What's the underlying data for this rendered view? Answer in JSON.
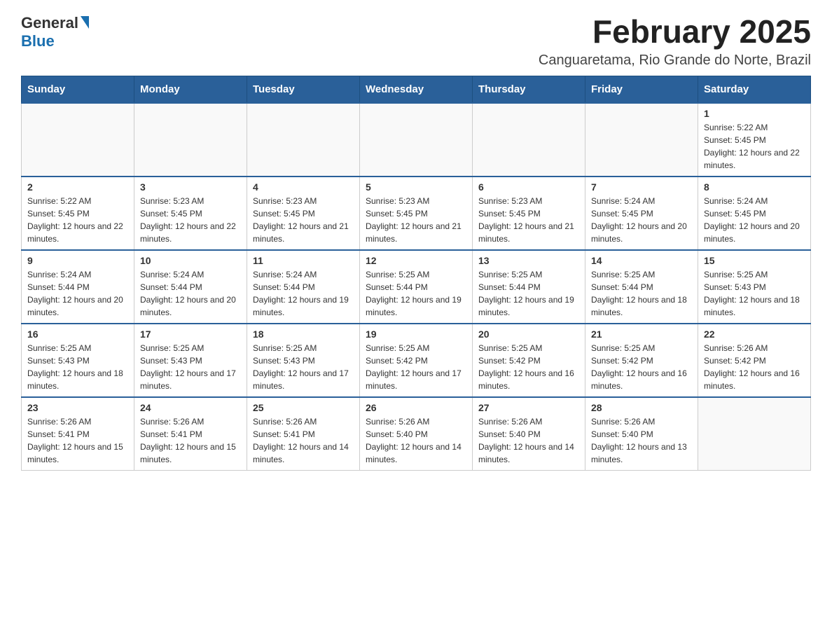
{
  "header": {
    "logo_general": "General",
    "logo_blue": "Blue",
    "title": "February 2025",
    "subtitle": "Canguaretama, Rio Grande do Norte, Brazil"
  },
  "days_of_week": [
    "Sunday",
    "Monday",
    "Tuesday",
    "Wednesday",
    "Thursday",
    "Friday",
    "Saturday"
  ],
  "weeks": [
    [
      {
        "day": "",
        "info": ""
      },
      {
        "day": "",
        "info": ""
      },
      {
        "day": "",
        "info": ""
      },
      {
        "day": "",
        "info": ""
      },
      {
        "day": "",
        "info": ""
      },
      {
        "day": "",
        "info": ""
      },
      {
        "day": "1",
        "info": "Sunrise: 5:22 AM\nSunset: 5:45 PM\nDaylight: 12 hours and 22 minutes."
      }
    ],
    [
      {
        "day": "2",
        "info": "Sunrise: 5:22 AM\nSunset: 5:45 PM\nDaylight: 12 hours and 22 minutes."
      },
      {
        "day": "3",
        "info": "Sunrise: 5:23 AM\nSunset: 5:45 PM\nDaylight: 12 hours and 22 minutes."
      },
      {
        "day": "4",
        "info": "Sunrise: 5:23 AM\nSunset: 5:45 PM\nDaylight: 12 hours and 21 minutes."
      },
      {
        "day": "5",
        "info": "Sunrise: 5:23 AM\nSunset: 5:45 PM\nDaylight: 12 hours and 21 minutes."
      },
      {
        "day": "6",
        "info": "Sunrise: 5:23 AM\nSunset: 5:45 PM\nDaylight: 12 hours and 21 minutes."
      },
      {
        "day": "7",
        "info": "Sunrise: 5:24 AM\nSunset: 5:45 PM\nDaylight: 12 hours and 20 minutes."
      },
      {
        "day": "8",
        "info": "Sunrise: 5:24 AM\nSunset: 5:45 PM\nDaylight: 12 hours and 20 minutes."
      }
    ],
    [
      {
        "day": "9",
        "info": "Sunrise: 5:24 AM\nSunset: 5:44 PM\nDaylight: 12 hours and 20 minutes."
      },
      {
        "day": "10",
        "info": "Sunrise: 5:24 AM\nSunset: 5:44 PM\nDaylight: 12 hours and 20 minutes."
      },
      {
        "day": "11",
        "info": "Sunrise: 5:24 AM\nSunset: 5:44 PM\nDaylight: 12 hours and 19 minutes."
      },
      {
        "day": "12",
        "info": "Sunrise: 5:25 AM\nSunset: 5:44 PM\nDaylight: 12 hours and 19 minutes."
      },
      {
        "day": "13",
        "info": "Sunrise: 5:25 AM\nSunset: 5:44 PM\nDaylight: 12 hours and 19 minutes."
      },
      {
        "day": "14",
        "info": "Sunrise: 5:25 AM\nSunset: 5:44 PM\nDaylight: 12 hours and 18 minutes."
      },
      {
        "day": "15",
        "info": "Sunrise: 5:25 AM\nSunset: 5:43 PM\nDaylight: 12 hours and 18 minutes."
      }
    ],
    [
      {
        "day": "16",
        "info": "Sunrise: 5:25 AM\nSunset: 5:43 PM\nDaylight: 12 hours and 18 minutes."
      },
      {
        "day": "17",
        "info": "Sunrise: 5:25 AM\nSunset: 5:43 PM\nDaylight: 12 hours and 17 minutes."
      },
      {
        "day": "18",
        "info": "Sunrise: 5:25 AM\nSunset: 5:43 PM\nDaylight: 12 hours and 17 minutes."
      },
      {
        "day": "19",
        "info": "Sunrise: 5:25 AM\nSunset: 5:42 PM\nDaylight: 12 hours and 17 minutes."
      },
      {
        "day": "20",
        "info": "Sunrise: 5:25 AM\nSunset: 5:42 PM\nDaylight: 12 hours and 16 minutes."
      },
      {
        "day": "21",
        "info": "Sunrise: 5:25 AM\nSunset: 5:42 PM\nDaylight: 12 hours and 16 minutes."
      },
      {
        "day": "22",
        "info": "Sunrise: 5:26 AM\nSunset: 5:42 PM\nDaylight: 12 hours and 16 minutes."
      }
    ],
    [
      {
        "day": "23",
        "info": "Sunrise: 5:26 AM\nSunset: 5:41 PM\nDaylight: 12 hours and 15 minutes."
      },
      {
        "day": "24",
        "info": "Sunrise: 5:26 AM\nSunset: 5:41 PM\nDaylight: 12 hours and 15 minutes."
      },
      {
        "day": "25",
        "info": "Sunrise: 5:26 AM\nSunset: 5:41 PM\nDaylight: 12 hours and 14 minutes."
      },
      {
        "day": "26",
        "info": "Sunrise: 5:26 AM\nSunset: 5:40 PM\nDaylight: 12 hours and 14 minutes."
      },
      {
        "day": "27",
        "info": "Sunrise: 5:26 AM\nSunset: 5:40 PM\nDaylight: 12 hours and 14 minutes."
      },
      {
        "day": "28",
        "info": "Sunrise: 5:26 AM\nSunset: 5:40 PM\nDaylight: 12 hours and 13 minutes."
      },
      {
        "day": "",
        "info": ""
      }
    ]
  ]
}
